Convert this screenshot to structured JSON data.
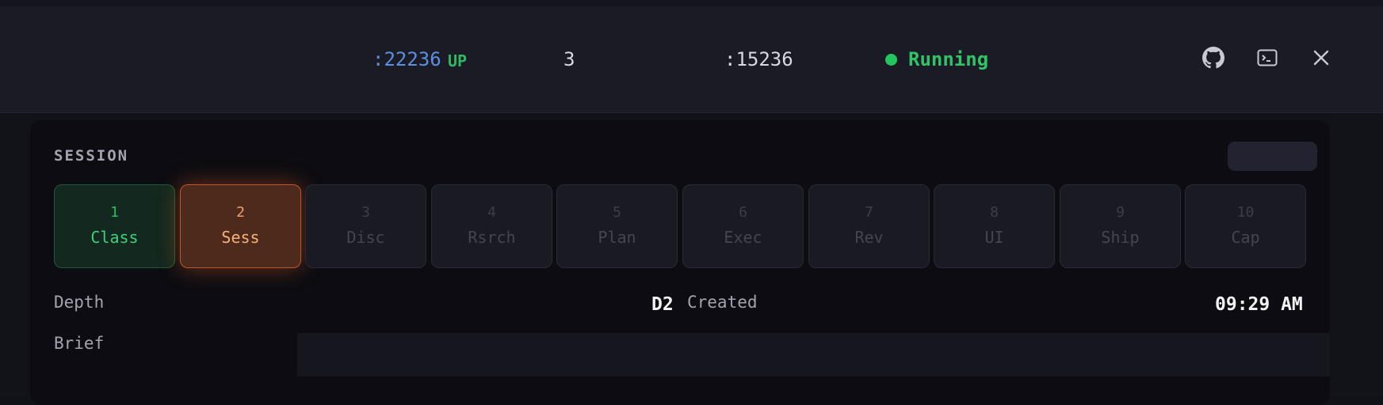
{
  "header": {
    "port_primary": ":22236",
    "port_primary_state": "UP",
    "count": "3",
    "port_secondary": ":15236",
    "status": "Running",
    "status_color": "#22c55e",
    "icons": [
      "github-icon",
      "terminal-icon",
      "close-icon"
    ]
  },
  "session": {
    "title": "SESSION",
    "steps": [
      {
        "num": "1",
        "label": "Class",
        "state": "done"
      },
      {
        "num": "2",
        "label": "Sess",
        "state": "active"
      },
      {
        "num": "3",
        "label": "Disc",
        "state": "pending"
      },
      {
        "num": "4",
        "label": "Rsrch",
        "state": "pending"
      },
      {
        "num": "5",
        "label": "Plan",
        "state": "pending"
      },
      {
        "num": "6",
        "label": "Exec",
        "state": "pending"
      },
      {
        "num": "7",
        "label": "Rev",
        "state": "pending"
      },
      {
        "num": "8",
        "label": "UI",
        "state": "pending"
      },
      {
        "num": "9",
        "label": "Ship",
        "state": "pending"
      },
      {
        "num": "10",
        "label": "Cap",
        "state": "pending"
      }
    ],
    "depth_label": "Depth",
    "depth_value": "D2",
    "created_label": "Created",
    "created_time": "09:29 AM",
    "brief_label": "Brief",
    "brief_value": ""
  }
}
